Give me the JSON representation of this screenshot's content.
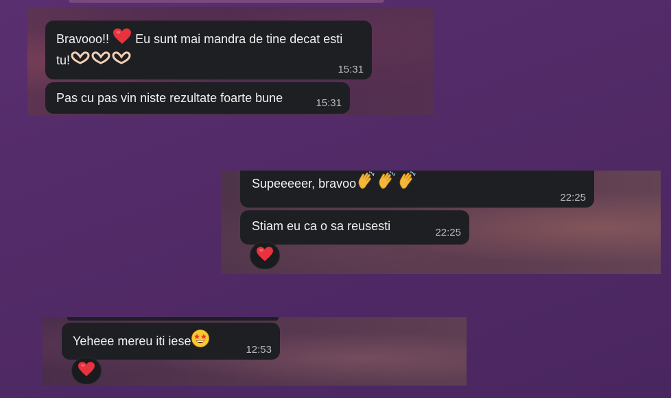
{
  "group_1": {
    "messages": [
      {
        "text_line_1_a": "Bravooo!!",
        "text_line_1_b": "Eu sunt mai mandra de tine decat esti",
        "text_line_2": "tu!",
        "emoji_inline": "red-heart",
        "emoji_trailing": [
          "heart-hands",
          "heart-hands",
          "heart-hands"
        ],
        "time": "15:31"
      },
      {
        "text": "Pas cu pas vin niste rezultate foarte bune",
        "time": "15:31"
      }
    ]
  },
  "group_2": {
    "messages": [
      {
        "text": "Supeeeeer, bravoo",
        "emoji_trailing": [
          "clapping-hands",
          "clapping-hands",
          "clapping-hands"
        ],
        "time": "22:25"
      },
      {
        "text": "Stiam eu ca o sa reusesti",
        "time": "22:25",
        "reaction": "red-heart"
      }
    ]
  },
  "group_3": {
    "messages": [
      {
        "text": "Yeheee mereu iti iese",
        "emoji_trailing": [
          "star-struck-face"
        ],
        "time": "12:53",
        "reaction": "red-heart"
      }
    ]
  },
  "colors": {
    "background": "#512a66",
    "bubble": "#1e1f22",
    "text": "#f1f1f1",
    "timestamp": "#b9babd",
    "heart": "#e8333f"
  }
}
